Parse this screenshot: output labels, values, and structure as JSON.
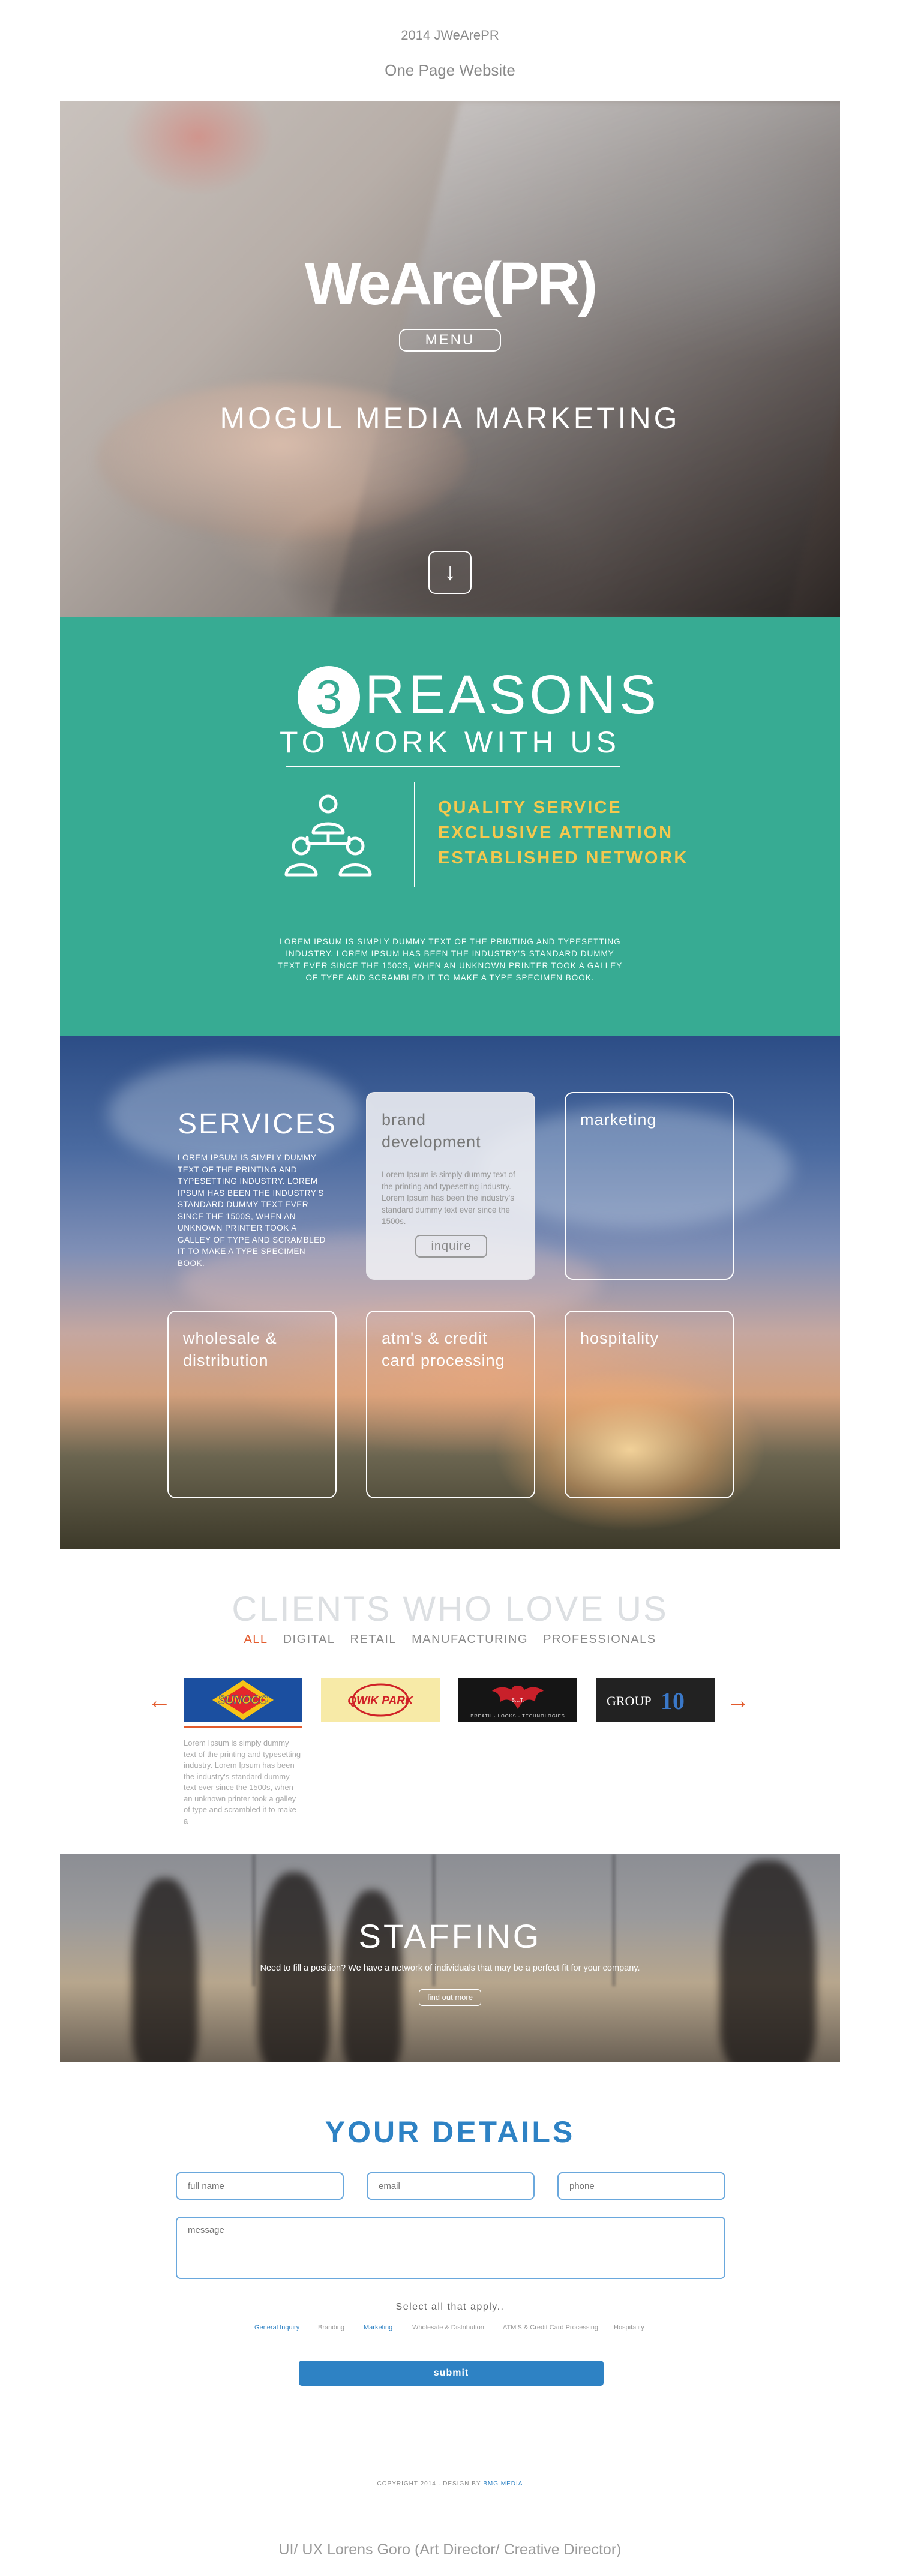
{
  "caption": {
    "year_line": "2014 JWeArePR",
    "subtitle": "One Page Website",
    "credit": "UI/ UX Lorens Goro (Art Director/ Creative Director)"
  },
  "hero": {
    "logo": "WeAre(PR)",
    "menu_label": "MENU",
    "tagline": "MOGUL MEDIA MARKETING",
    "down_icon": "arrow-down-icon"
  },
  "reasons": {
    "number": "3",
    "title": "REASONS",
    "subtitle": "TO WORK WITH US",
    "items": [
      "QUALITY SERVICE",
      "EXCLUSIVE ATTENTION",
      "ESTABLISHED NETWORK"
    ],
    "body": "LOREM IPSUM IS SIMPLY DUMMY TEXT OF THE PRINTING AND TYPESETTING INDUSTRY. LOREM IPSUM HAS BEEN THE INDUSTRY'S STANDARD DUMMY TEXT EVER SINCE THE 1500S, WHEN AN UNKNOWN PRINTER TOOK A GALLEY OF TYPE AND SCRAMBLED IT TO MAKE A TYPE SPECIMEN BOOK.",
    "colors": {
      "background": "#37ab93",
      "highlight": "#f5c84e"
    }
  },
  "services": {
    "title": "SERVICES",
    "body": "LOREM IPSUM IS SIMPLY DUMMY TEXT OF THE PRINTING AND TYPESETTING INDUSTRY. LOREM IPSUM HAS BEEN THE INDUSTRY'S STANDARD DUMMY TEXT EVER SINCE THE 1500S, WHEN AN UNKNOWN PRINTER TOOK A GALLEY OF TYPE AND SCRAMBLED IT TO MAKE A TYPE SPECIMEN BOOK.",
    "cards": [
      {
        "title": "brand development",
        "desc": "Lorem Ipsum is simply dummy text of the printing and typesetting industry. Lorem Ipsum has been the industry's standard dummy text ever since the 1500s.",
        "button": "inquire"
      },
      {
        "title": "marketing"
      },
      {
        "title": "wholesale & distribution"
      },
      {
        "title": "atm's & credit card processing"
      },
      {
        "title": "hospitality"
      }
    ]
  },
  "clients": {
    "title": "CLIENTS WHO LOVE US",
    "filters": [
      "ALL",
      "DIGITAL",
      "RETAIL",
      "MANUFACTURING",
      "PROFESSIONALS"
    ],
    "active_filter": "ALL",
    "logos": [
      {
        "name": "SUNOCO"
      },
      {
        "name": "QWIK PARK"
      },
      {
        "name": "B.L.T.",
        "sub": "BREATH · LOOKS · TECHNOLOGIES"
      },
      {
        "name": "GROUP",
        "num": "10"
      }
    ],
    "desc": "Lorem Ipsum is simply dummy text of the printing and typesetting industry. Lorem Ipsum has been the industry's standard dummy text ever since the 1500s, when an unknown printer took a galley of type and scrambled it to make a",
    "accent": "#e35b2d"
  },
  "staffing": {
    "title": "STAFFING",
    "text": "Need to fill a position? We have a network of individuals that may be a perfect fit for your company.",
    "button": "find out more"
  },
  "details": {
    "title": "YOUR DETAILS",
    "placeholders": {
      "name": "full name",
      "email": "email",
      "phone": "phone",
      "message": "message"
    },
    "select_label": "Select all that apply..",
    "options": [
      {
        "label": "General Inquiry",
        "selected": true
      },
      {
        "label": "Branding",
        "selected": false
      },
      {
        "label": "Marketing",
        "selected": true
      },
      {
        "label": "Wholesale & Distribution",
        "selected": false
      },
      {
        "label": "ATM'S & Credit Card Processing",
        "selected": false
      },
      {
        "label": "Hospitality",
        "selected": false
      }
    ],
    "submit": "submit",
    "accent": "#2e82c4"
  },
  "footer": {
    "copyright": "COPYRIGHT 2014 . DESIGN BY",
    "designer": "BMG MEDIA"
  }
}
